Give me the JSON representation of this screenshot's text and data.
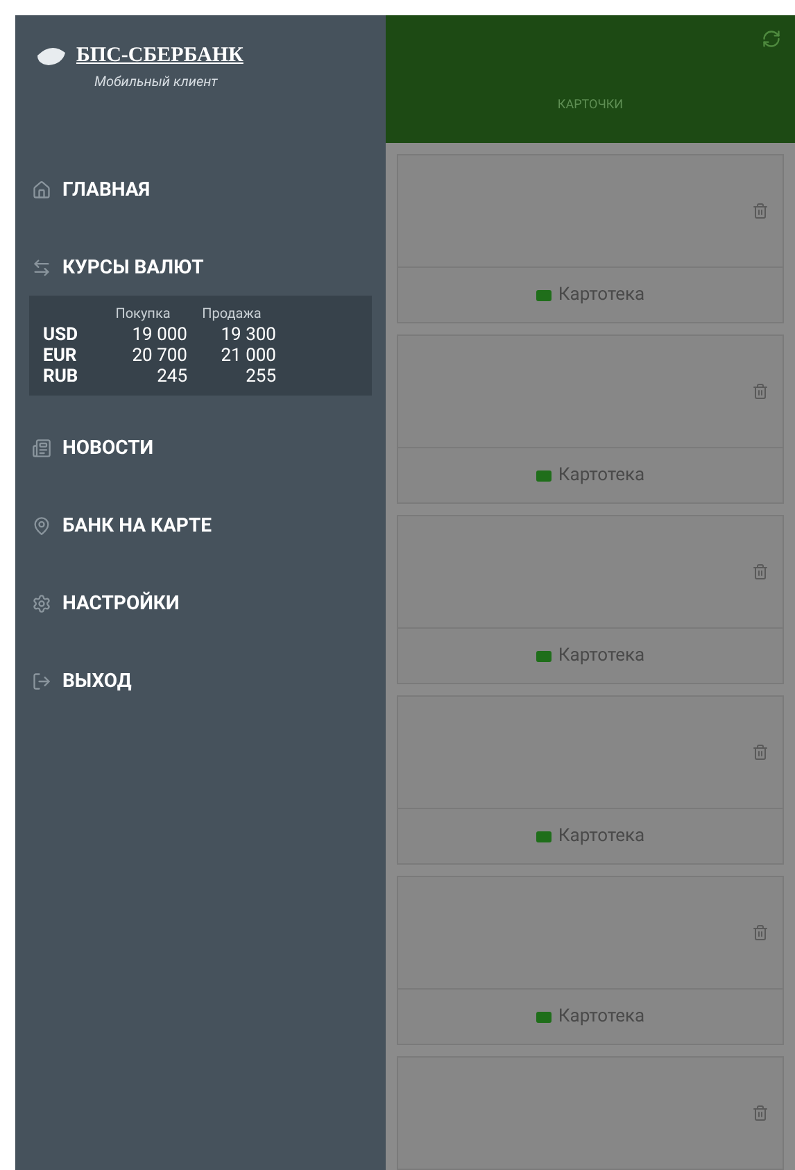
{
  "drawer": {
    "logo": {
      "title": "БПС-СБЕРБАНК",
      "subtitle": "Мобильный клиент"
    },
    "menu": [
      {
        "label": "ГЛАВНАЯ",
        "kind": "home"
      },
      {
        "label": "КУРСЫ ВАЛЮТ",
        "kind": "rates",
        "expanded": true
      },
      {
        "label": "НОВОСТИ",
        "kind": "news"
      },
      {
        "label": "БАНК НА КАРТЕ",
        "kind": "map"
      },
      {
        "label": "НАСТРОЙКИ",
        "kind": "settings"
      },
      {
        "label": "ВЫХОД",
        "kind": "exit"
      }
    ],
    "rates": {
      "columns": [
        "Покупка",
        "Продажа"
      ],
      "rows": [
        {
          "currency": "USD",
          "buy": "19 000",
          "sell": "19 300"
        },
        {
          "currency": "EUR",
          "buy": "20 700",
          "sell": "21 000"
        },
        {
          "currency": "RUB",
          "buy": "245",
          "sell": "255"
        }
      ]
    }
  },
  "tabs": [
    {
      "label": "КАРТОЧКИ",
      "selected": true
    }
  ],
  "cards": [
    {
      "action": "Картотека",
      "deletable": true
    },
    {
      "action": "Картотека",
      "deletable": true
    },
    {
      "action": "Картотека",
      "deletable": true
    },
    {
      "action": "Картотека",
      "deletable": true
    },
    {
      "action": "Картотека",
      "deletable": true
    },
    {
      "deletable": true
    }
  ]
}
